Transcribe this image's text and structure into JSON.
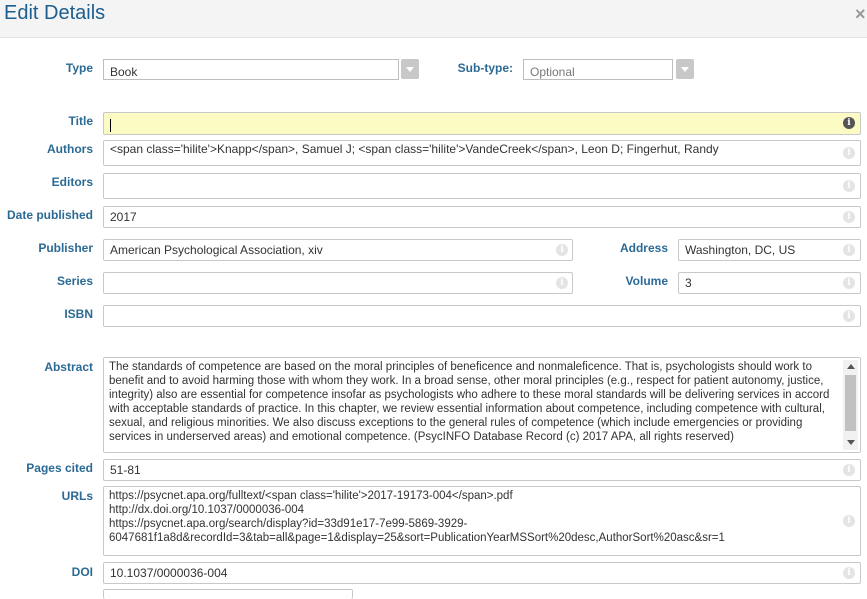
{
  "dialog": {
    "title": "Edit Details",
    "close_symbol": "×"
  },
  "type": {
    "label": "Type",
    "value": "Book"
  },
  "subtype": {
    "label": "Sub-type:",
    "placeholder": "Optional"
  },
  "fields": {
    "title": {
      "label": "Title",
      "value": ""
    },
    "authors": {
      "label": "Authors",
      "value": "<span class='hilite'>Knapp</span>, Samuel J; <span class='hilite'>VandeCreek</span>, Leon D; Fingerhut, Randy"
    },
    "editors": {
      "label": "Editors",
      "value": ""
    },
    "date_published": {
      "label": "Date published",
      "value": "2017"
    },
    "publisher": {
      "label": "Publisher",
      "value": "American Psychological Association,  xiv"
    },
    "address": {
      "label": "Address",
      "value": "Washington,  DC,  US"
    },
    "series": {
      "label": "Series",
      "value": ""
    },
    "volume": {
      "label": "Volume",
      "value": "3"
    },
    "isbn": {
      "label": "ISBN",
      "value": ""
    },
    "abstract": {
      "label": "Abstract",
      "value": "The standards of competence are based on the moral principles of beneficence and nonmaleficence. That is, psychologists should work to benefit and to avoid harming those with whom they work. In a broad sense, other moral principles (e.g., respect for patient autonomy, justice, integrity) also are essential for competence insofar as psychologists who adhere to these moral standards will be delivering services in accord with acceptable standards of practice. In this chapter, we review essential information about competence, including competence with cultural, sexual, and religious minorities. We also discuss exceptions to the general rules of competence (which include emergencies or providing services in underserved areas) and emotional competence. (PsycINFO Database Record (c) 2017 APA, all rights reserved)"
    },
    "pages_cited": {
      "label": "Pages cited",
      "value": "51-81"
    },
    "urls": {
      "label": "URLs",
      "value": "https://psycnet.apa.org/fulltext/<span class='hilite'>2017-19173-004</span>.pdf\nhttp://dx.doi.org/10.1037/0000036-004\nhttps://psycnet.apa.org/search/display?id=33d91e17-7e99-5869-3929-\n6047681f1a8d&recordId=3&tab=all&page=1&display=25&sort=PublicationYearMSSort%20desc,AuthorSort%20asc&sr=1"
    },
    "doi": {
      "label": "DOI",
      "value": "10.1037/0000036-004"
    }
  },
  "info_icon_glyph": "i"
}
